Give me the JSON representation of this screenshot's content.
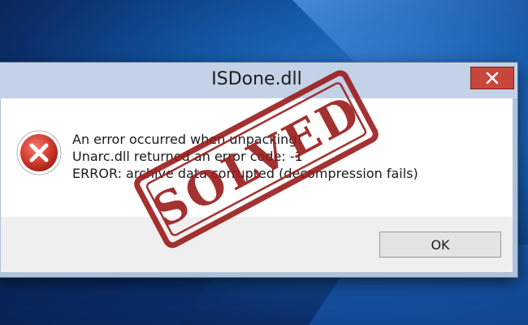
{
  "dialog": {
    "title": "ISDone.dll",
    "icon": "error-icon",
    "messages": [
      "An error occurred when unpacking!",
      "Unarc.dll returned an error code: -1",
      "ERROR: archive data corrupted (decompression fails)"
    ],
    "ok_label": "OK",
    "close_icon": "close-icon"
  },
  "stamp": {
    "text": "SOLVED",
    "color": "#9b1b1b"
  },
  "colors": {
    "titlebar": "#c3d2e6",
    "close_button": "#c9463d",
    "error_icon": "#d23a2f"
  }
}
